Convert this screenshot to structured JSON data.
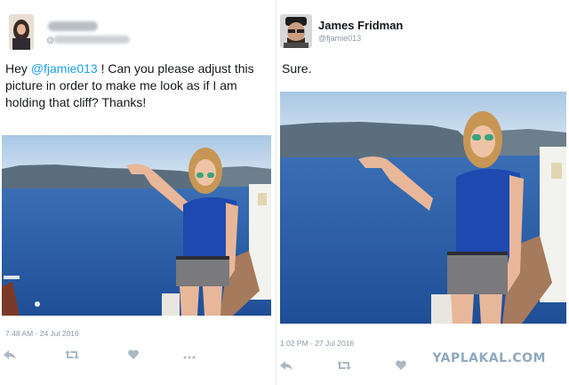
{
  "left_tweet": {
    "author": {
      "handle_prefix": "@"
    },
    "text_before": "Hey ",
    "mention": "@fjamie013",
    "text_after": " ! Can you please adjust this picture in order to make me look as if I am holding that cliff? Thanks!",
    "timestamp": "7:48 AM - 24 Jul 2016",
    "icons": [
      "reply-icon",
      "retweet-icon",
      "like-icon",
      "more-icon"
    ]
  },
  "right_tweet": {
    "author": {
      "name": "James Fridman",
      "handle": "@fjamie013"
    },
    "text": "Sure.",
    "timestamp": "1:02 PM - 27 Jul 2016",
    "icons": [
      "reply-icon",
      "retweet-icon",
      "like-icon"
    ]
  },
  "watermark": "YAPLAKAL.COM",
  "colors": {
    "link": "#1da1f2",
    "muted": "#8899a6",
    "icon": "#aab8c2",
    "sea": "#2a5da8",
    "sky": "#cfe1f0"
  }
}
